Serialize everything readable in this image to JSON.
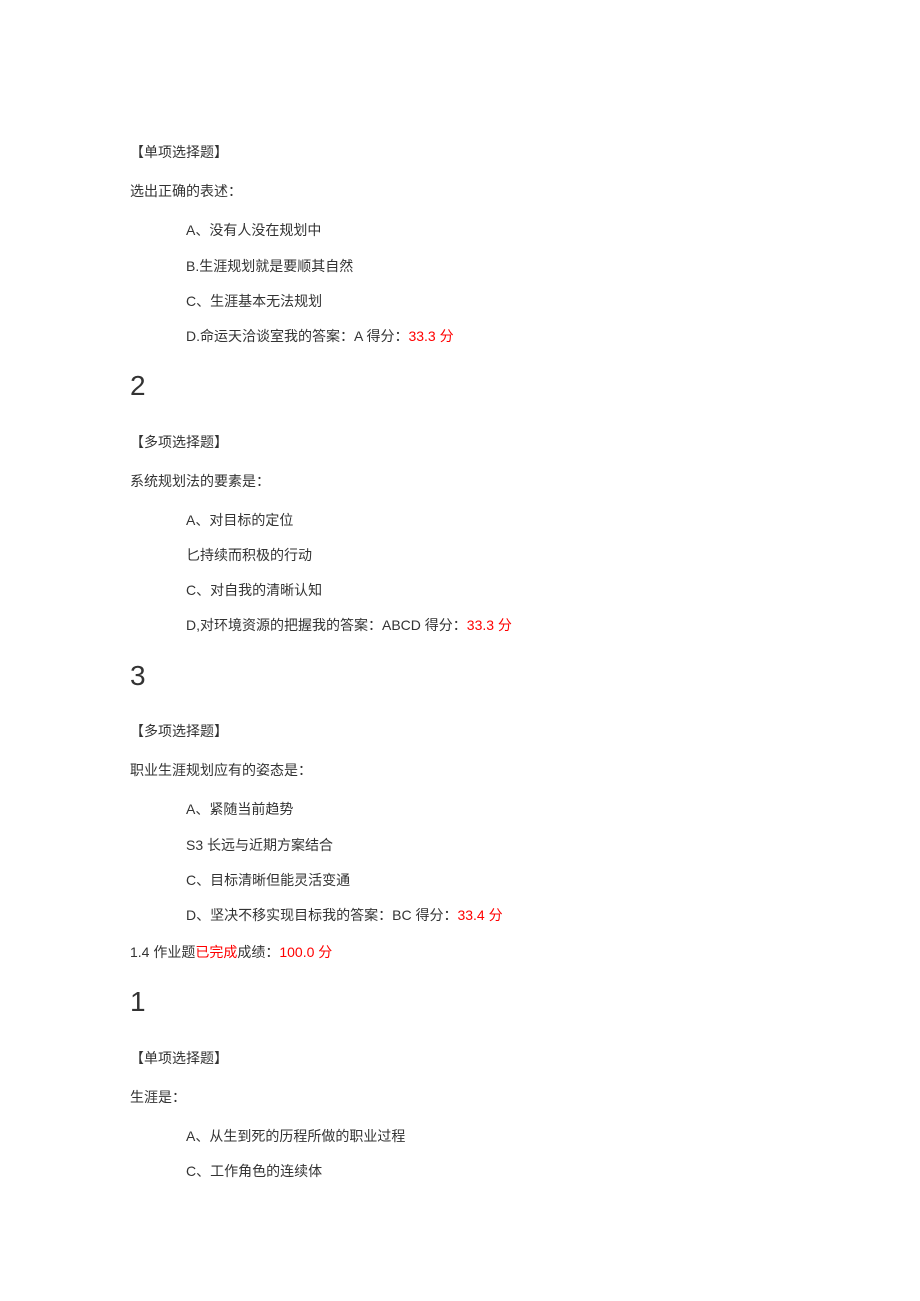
{
  "q1": {
    "type": "【单项选择题】",
    "text": "选出正确的表述：",
    "opts": {
      "a": "A、没有人没在规划中",
      "b": "B.生涯规划就是要顺其自然",
      "c": "C、生涯基本无法规划",
      "d_pre": "D.命运天洽谈室我的答案：A 得分：",
      "d_red": "33.3 分"
    }
  },
  "num2": "2",
  "q2": {
    "type": "【多项选择题】",
    "text": "系统规划法的要素是：",
    "opts": {
      "a": "A、对目标的定位",
      "b": "匕持续而积极的行动",
      "c": "C、对自我的清晰认知",
      "d_pre": "D,对环境资源的把握我的答案：ABCD 得分：",
      "d_red": "33.3 分"
    }
  },
  "num3": "3",
  "q3": {
    "type": "【多项选择题】",
    "text": "职业生涯规划应有的姿态是：",
    "opts": {
      "a": "A、紧随当前趋势",
      "b": "S3 长远与近期方案结合",
      "c": "C、目标清晰但能灵活变通",
      "d_pre": "D、坚决不移实现目标我的答案：BC 得分：",
      "d_red": "33.4 分"
    }
  },
  "section": {
    "prefix": "1.4 ",
    "t1": "作业题",
    "done": "已完成",
    "t2": "成绩：",
    "score": "100.0 ",
    "unit": "分"
  },
  "num1b": "1",
  "q4": {
    "type": "【单项选择题】",
    "text": "生涯是：",
    "opts": {
      "a": "A、从生到死的历程所做的职业过程",
      "c": "C、工作角色的连续体"
    }
  }
}
